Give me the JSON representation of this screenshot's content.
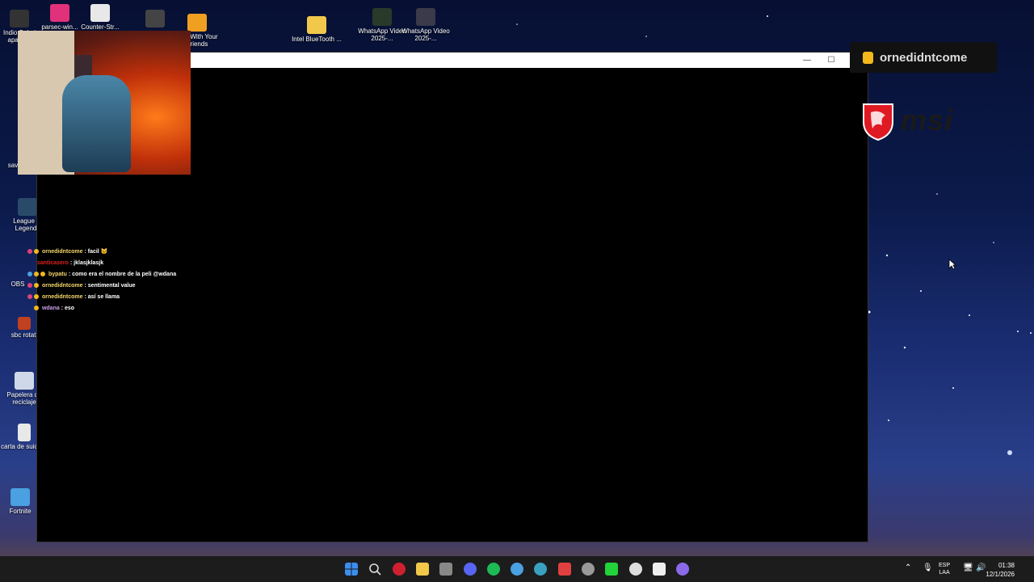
{
  "desktop_icons": [
    {
      "label": "Indio Solari aparece",
      "color": "#333333"
    },
    {
      "label": "parsec-win...",
      "color": "#e0317a"
    },
    {
      "label": "Counter-Str...",
      "color": "#e8e8e8"
    },
    {
      "label": "",
      "color": "#444444"
    },
    {
      "label": "Golf With Your Friends",
      "color": "#f0a020"
    },
    {
      "label": "Intel BlueTooth ...",
      "color": "#f2c84b"
    },
    {
      "label": "WhatsApp Video 2025-...",
      "color": "#2a3a2a"
    },
    {
      "label": "WhatsApp Video 2025-...",
      "color": "#3a3a4a"
    }
  ],
  "left_icons": [
    {
      "label": "sav",
      "color": "#2a2a2a"
    },
    {
      "label": "League of Legends",
      "color": "#2a4a6a"
    },
    {
      "label": "OBS",
      "color": "#222222"
    },
    {
      "label": "sbc rotati",
      "color": "#c04020"
    },
    {
      "label": "Papelera de reciclaje",
      "color": "#cfd8e8"
    },
    {
      "label": "carta de suicidio",
      "color": "#e8e8e8"
    },
    {
      "label": "Fortnite",
      "color": "#4aa0e0"
    }
  ],
  "window": {
    "minimize_glyph": "—",
    "maximize_glyph": "☐"
  },
  "chat": [
    {
      "user": "ornedidntcome",
      "user_color": "#f5d76e",
      "message": "facil 🐱",
      "badges": [
        "#e0407a",
        "#f2b81c"
      ]
    },
    {
      "user": "santicasero",
      "user_color": "#e02020",
      "message": "jklasjklasjk",
      "badges": []
    },
    {
      "user": "bypatu",
      "user_color": "#f5d76e",
      "message": "como era el nombre de la peli @wdana",
      "badges": [
        "#4aa0e0",
        "#f2b81c",
        "#f2b81c"
      ]
    },
    {
      "user": "ornedidntcome",
      "user_color": "#f5d76e",
      "message": "sentimental value",
      "badges": [
        "#e0407a",
        "#f2b81c"
      ]
    },
    {
      "user": "ornedidntcome",
      "user_color": "#f5d76e",
      "message": "así se llama",
      "badges": [
        "#e0407a",
        "#f2b81c"
      ]
    },
    {
      "user": "wdana",
      "user_color": "#c8a0e8",
      "message": "eso",
      "badges": [
        "#f2b81c"
      ]
    }
  ],
  "toast": {
    "username": "ornedidntcome"
  },
  "brand": {
    "logo_text": "msi"
  },
  "taskbar": {
    "apps": [
      {
        "name": "start-icon",
        "color": "#3b8ef0"
      },
      {
        "name": "search-icon",
        "color": "#dddddd"
      },
      {
        "name": "app-red-icon",
        "color": "#d02030"
      },
      {
        "name": "file-explorer-icon",
        "color": "#f2c84b"
      },
      {
        "name": "store-icon",
        "color": "#888888"
      },
      {
        "name": "discord-icon",
        "color": "#5865f2"
      },
      {
        "name": "spotify-icon",
        "color": "#1db954"
      },
      {
        "name": "chrome-icon",
        "color": "#4aa0e0"
      },
      {
        "name": "browser-icon",
        "color": "#3aa0c0"
      },
      {
        "name": "fraps-icon",
        "color": "#e04040"
      },
      {
        "name": "steam-icon",
        "color": "#999999"
      },
      {
        "name": "kick-icon",
        "color": "#22d33a"
      },
      {
        "name": "app-face-icon",
        "color": "#dddddd"
      },
      {
        "name": "terminal-icon",
        "color": "#eeeeee"
      },
      {
        "name": "twitch-studio-icon",
        "color": "#8a6ae8"
      }
    ],
    "lang_top": "ESP",
    "lang_bottom": "LAA",
    "time": "01:38",
    "date": "12/1/2026"
  }
}
